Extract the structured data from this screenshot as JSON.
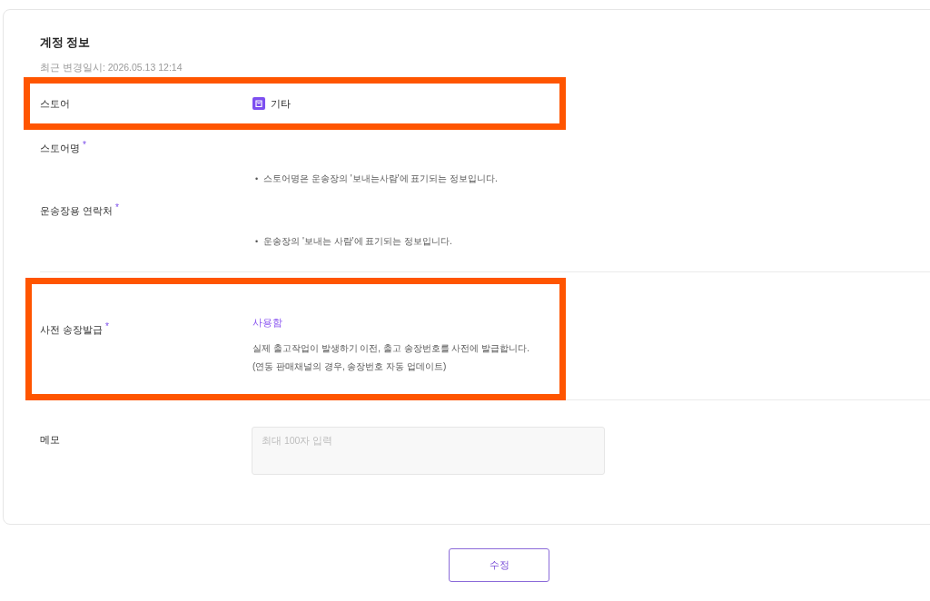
{
  "section": {
    "title": "계정 정보",
    "updated": "최근 변경일시: 2026.05.13 12:14"
  },
  "groups": [
    {
      "rows": [
        {
          "kind": "store",
          "label": "스토어",
          "highlighted": true,
          "value": "기타"
        },
        {
          "kind": "help",
          "label": "스토어명",
          "required_mark": "*",
          "highlighted": false,
          "bullet": "•",
          "help": "스토어명은 운송장의 '보내는사람'에 표기되는 정보입니다."
        },
        {
          "kind": "help",
          "label": "운송장용 연락처",
          "required_mark": "*",
          "highlighted": false,
          "bullet": "•",
          "help": "운송장의 '보내는 사람'에 표기되는 정보입니다."
        }
      ]
    },
    {
      "rows": [
        {
          "kind": "option",
          "label": "사전 송장발급",
          "required_mark": "*",
          "highlighted": true,
          "value": "사용함",
          "description": [
            "실제 출고작업이 발생하기 이전, 출고 송장번호를 사전에 발급합니다.",
            "(연동 판매채널의 경우, 송장번호 자동 업데이트)"
          ]
        }
      ]
    },
    {
      "rows": [
        {
          "kind": "memo",
          "label": "메모",
          "highlighted": false,
          "placeholder": "최대 100자 입력"
        }
      ]
    }
  ],
  "buttons": [
    {
      "label": "수정"
    }
  ]
}
